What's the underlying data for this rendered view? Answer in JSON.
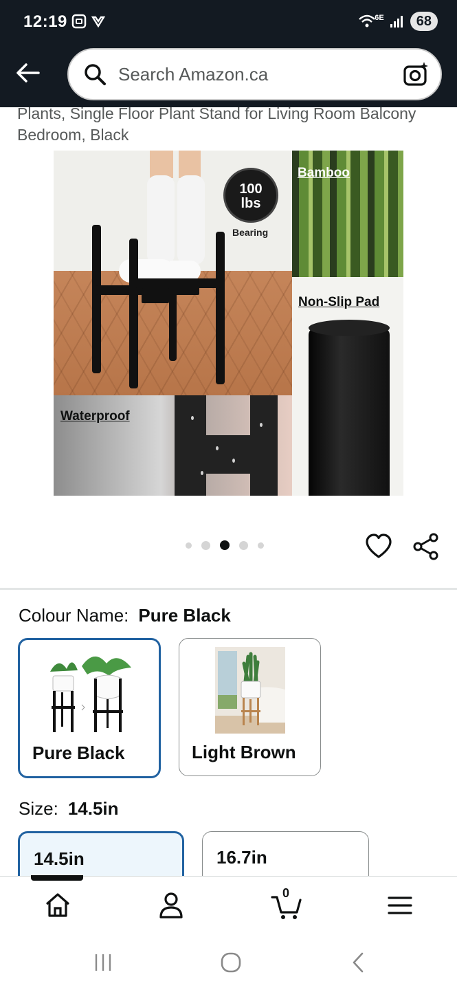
{
  "status_bar": {
    "time": "12:19",
    "network": "6E",
    "battery": "68"
  },
  "header": {
    "search_placeholder": "Search Amazon.ca",
    "icons": [
      "back-arrow-icon",
      "search-icon",
      "camera-lens-icon"
    ]
  },
  "product": {
    "title": "Plants, Single Floor Plant Stand for Living Room Balcony Bedroom, Black",
    "image": {
      "badge_number": "100",
      "badge_unit": "lbs",
      "badge_caption": "Bearing",
      "feature_bamboo": "Bamboo",
      "feature_pad": "Non-Slip Pad",
      "feature_waterproof": "Waterproof"
    },
    "carousel": {
      "count": 5,
      "active_index": 2
    }
  },
  "colour": {
    "label": "Colour Name:",
    "selected": "Pure Black",
    "options": [
      {
        "label": "Pure Black",
        "selected": true
      },
      {
        "label": "Light Brown",
        "selected": false
      }
    ]
  },
  "size": {
    "label": "Size:",
    "selected": "14.5in",
    "options": [
      {
        "label": "14.5in",
        "selected": true
      },
      {
        "label": "16.7in",
        "selected": false
      }
    ]
  },
  "bottom_nav": {
    "items": [
      "home-icon",
      "account-icon",
      "cart-icon",
      "menu-icon"
    ],
    "cart_count": "0"
  },
  "colors": {
    "header_bg": "#131a22",
    "selected_border": "#2162a1",
    "text": "#0f1111",
    "muted": "#565959"
  }
}
